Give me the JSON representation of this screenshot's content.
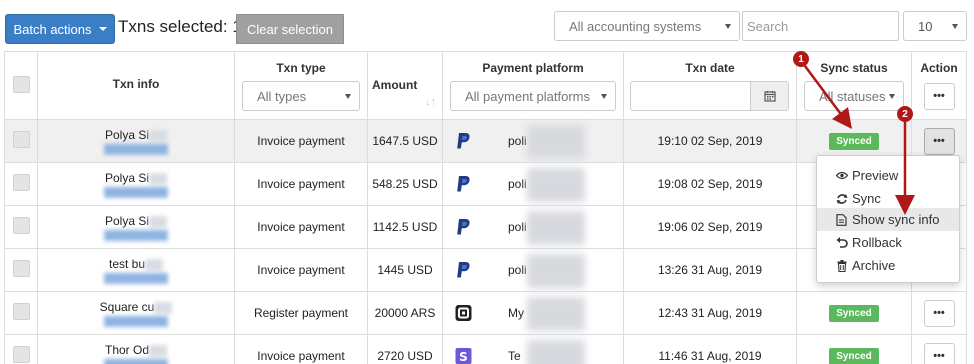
{
  "toolbar": {
    "batch_label": "Batch actions",
    "selected_text": "Txns selected: 1",
    "clear_label": "Clear selection",
    "accounting_select": "All accounting systems",
    "search_placeholder": "Search",
    "page_size": "10"
  },
  "columns": {
    "txn_info": "Txn info",
    "txn_type": "Txn type",
    "txn_type_filter": "All types",
    "amount": "Amount",
    "platform": "Payment platform",
    "platform_filter": "All payment platforms",
    "txn_date": "Txn date",
    "sync_status": "Sync status",
    "sync_filter": "All statuses",
    "action": "Action"
  },
  "rows": [
    {
      "name": "Polya Si",
      "type": "Invoice payment",
      "amount": "1647.5 USD",
      "platform_icon": "paypal-icon",
      "platform": "poli",
      "date": "19:10 02 Sep, 2019",
      "status": "Synced",
      "action": "•••"
    },
    {
      "name": "Polya Si",
      "type": "Invoice payment",
      "amount": "548.25 USD",
      "platform_icon": "paypal-icon",
      "platform": "poli",
      "date": "19:08 02 Sep, 2019",
      "status": "",
      "action": ""
    },
    {
      "name": "Polya Si",
      "type": "Invoice payment",
      "amount": "1142.5 USD",
      "platform_icon": "paypal-icon",
      "platform": "poli",
      "date": "19:06 02 Sep, 2019",
      "status": "",
      "action": ""
    },
    {
      "name": "test bu",
      "type": "Invoice payment",
      "amount": "1445 USD",
      "platform_icon": "paypal-icon",
      "platform": "poli",
      "date": "13:26 31 Aug, 2019",
      "status": "",
      "action": ""
    },
    {
      "name": "Square cu",
      "type": "Register payment",
      "amount": "20000 ARS",
      "platform_icon": "square-icon",
      "platform": "My",
      "date": "12:43 31 Aug, 2019",
      "status": "Synced",
      "action": "•••"
    },
    {
      "name": "Thor Od",
      "type": "Invoice payment",
      "amount": "2720 USD",
      "platform_icon": "stripe-icon",
      "platform": "Te",
      "date": "11:46 31 Aug, 2019",
      "status": "Synced",
      "action": "•••"
    }
  ],
  "action_menu": {
    "items": [
      "Preview",
      "Sync",
      "Show sync info",
      "Rollback",
      "Archive"
    ],
    "icons": [
      "eye-icon",
      "refresh-icon",
      "document-icon",
      "undo-icon",
      "trash-icon"
    ],
    "active_index": 2
  },
  "annotations": {
    "step1": "1",
    "step2": "2"
  },
  "colors": {
    "primary": "#3a7fc6",
    "synced": "#5cb85c",
    "annotation": "#b01818",
    "paypal": "#253b80",
    "stripe": "#6a5ad8"
  }
}
